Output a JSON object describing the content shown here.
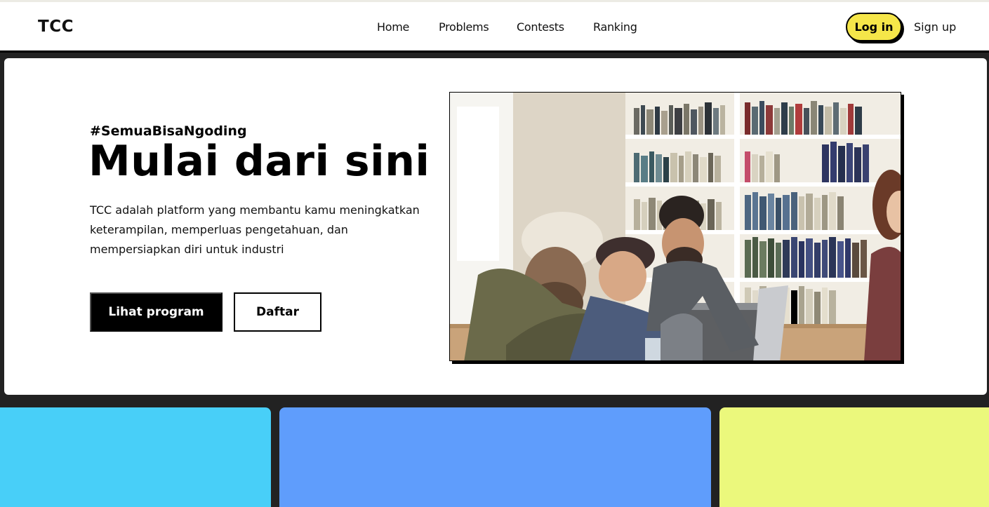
{
  "brand": "TCC",
  "nav": {
    "items": [
      {
        "label": "Home"
      },
      {
        "label": "Problems"
      },
      {
        "label": "Contests"
      },
      {
        "label": "Ranking"
      }
    ],
    "login_label": "Log in",
    "signup_label": "Sign up"
  },
  "hero": {
    "hashtag": "#SemuaBisaNgoding",
    "headline": "Mulai dari sini",
    "description": "TCC adalah platform yang membantu kamu meningkatkan keterampilan, memperluas pengetahuan, dan mempersiapkan diri untuk industri",
    "primary_cta": "Lihat program",
    "secondary_cta": "Daftar"
  },
  "colors": {
    "accent_yellow": "#f5e649",
    "card_cyan": "#48cff8",
    "card_blue": "#5f9dfc",
    "card_lime": "#ebf87c",
    "page_dark": "#222222"
  }
}
